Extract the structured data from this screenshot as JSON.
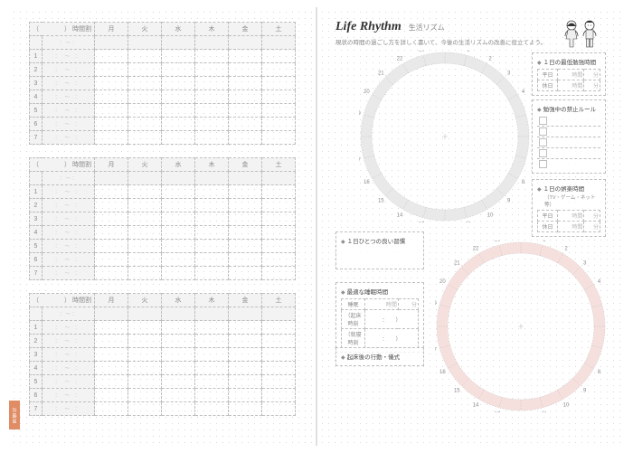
{
  "left": {
    "tab_label": "習慣化",
    "timetable": {
      "header_paren_open": "（",
      "header_paren_close": "）",
      "header_jikanwari": "時間割",
      "days": [
        "月",
        "火",
        "水",
        "木",
        "金",
        "土"
      ],
      "row_count": 7,
      "row_numbers": [
        "1",
        "2",
        "3",
        "4",
        "5",
        "6",
        "7"
      ],
      "time_placeholder": "： 〜 ："
    },
    "blocks": 3
  },
  "right": {
    "title_en": "Life Rhythm",
    "title_jp": "生活リズム",
    "lead": "現状の時間の過ごし方を詳しく書いて、今後の生活リズムの改善に役立てよう。",
    "clock_hours": {
      "min": 1,
      "max": 24
    },
    "boxes": {
      "min_study": {
        "title": "１日の最低勉強時間",
        "rows": [
          {
            "label": "平日",
            "unit1": "時間",
            "unit2": "分"
          },
          {
            "label": "休日",
            "unit1": "時間",
            "unit2": "分"
          }
        ]
      },
      "rules": {
        "title": "勉強中の禁止ルール",
        "items": 5
      },
      "entertainment": {
        "title": "１日の娯楽時間",
        "subtitle": "（TV・ゲーム・ネット等）",
        "rows": [
          {
            "label": "平日",
            "unit1": "時間",
            "unit2": "分"
          },
          {
            "label": "休日",
            "unit1": "時間",
            "unit2": "分"
          }
        ]
      },
      "habit": {
        "title": "１日ひとつの良い習慣"
      },
      "sleep": {
        "title": "最適な睡眠時間",
        "row_sleep": {
          "label": "睡眠",
          "unit1": "時間",
          "unit2": "分"
        },
        "row_wake": {
          "label": "（起床時刻",
          "value": "：　　）"
        },
        "row_bed": {
          "label": "（就寝時刻",
          "value": "：　　）"
        }
      },
      "after_wake": {
        "title": "起床後の行動・儀式"
      }
    }
  }
}
